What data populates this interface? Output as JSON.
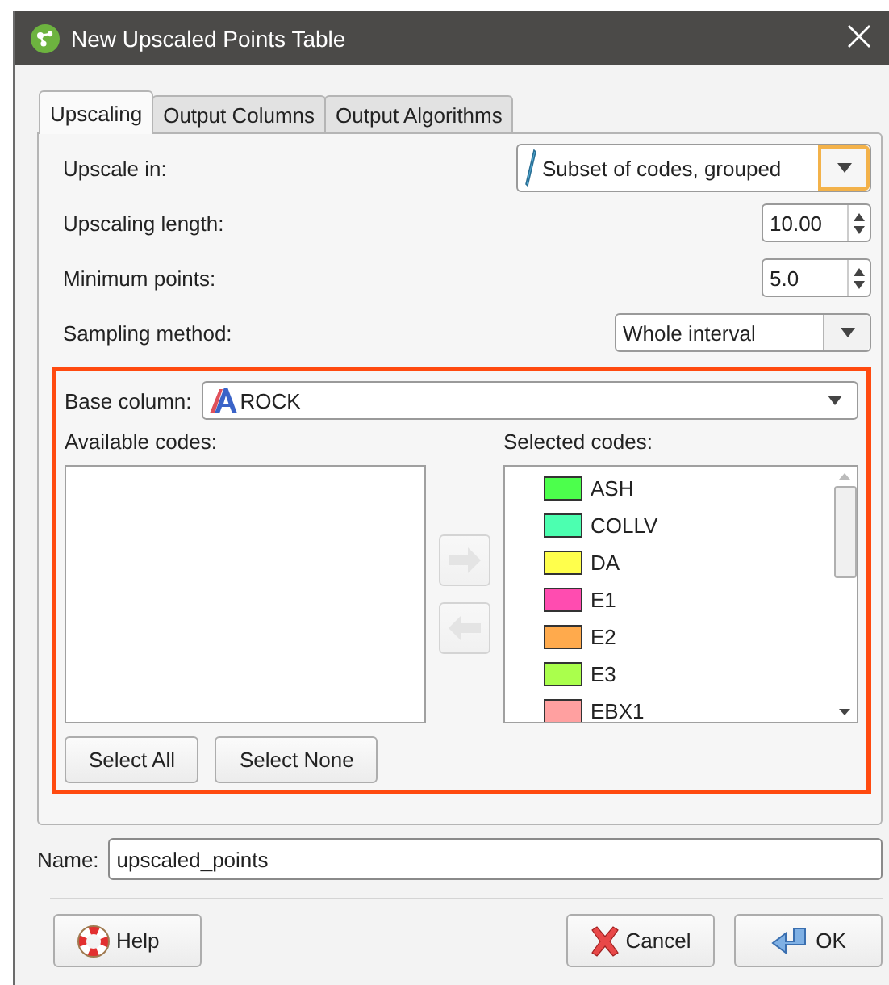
{
  "window": {
    "title": "New Upscaled Points Table"
  },
  "tabs": [
    {
      "label": "Upscaling",
      "selected": true
    },
    {
      "label": "Output Columns",
      "selected": false
    },
    {
      "label": "Output Algorithms",
      "selected": false
    }
  ],
  "fields": [
    {
      "kind": "icon_combo",
      "label": "Upscale in:",
      "value": "Subset of codes, grouped",
      "focused": true
    },
    {
      "kind": "spin",
      "label": "Upscaling length:",
      "value": "10.00"
    },
    {
      "kind": "spin",
      "label": "Minimum points:",
      "value": "5.0"
    },
    {
      "kind": "combo",
      "label": "Sampling method:",
      "value": "Whole interval",
      "focused": false
    }
  ],
  "codes_panel": {
    "base_column_label": "Base column:",
    "base_column_value": "ROCK",
    "available_label": "Available codes:",
    "selected_label": "Selected codes:",
    "selected_codes": [
      {
        "name": "ASH",
        "color": "#4cff4c"
      },
      {
        "name": "COLLV",
        "color": "#4cffb0"
      },
      {
        "name": "DA",
        "color": "#ffff4c"
      },
      {
        "name": "E1",
        "color": "#ff4cb0"
      },
      {
        "name": "E2",
        "color": "#ffaa4c"
      },
      {
        "name": "E3",
        "color": "#aaff4c"
      },
      {
        "name": "EBX1",
        "color": "#ffa0a0"
      }
    ],
    "move_right": {
      "disabled": true
    },
    "move_left": {
      "disabled": true
    },
    "buttons": [
      "Select All",
      "Select None"
    ]
  },
  "name_field": {
    "label": "Name:",
    "value": "upscaled_points"
  },
  "footer_buttons": [
    {
      "kind": "help",
      "label": "Help"
    },
    {
      "kind": "cancel",
      "label": "Cancel"
    },
    {
      "kind": "ok",
      "label": "OK"
    }
  ]
}
